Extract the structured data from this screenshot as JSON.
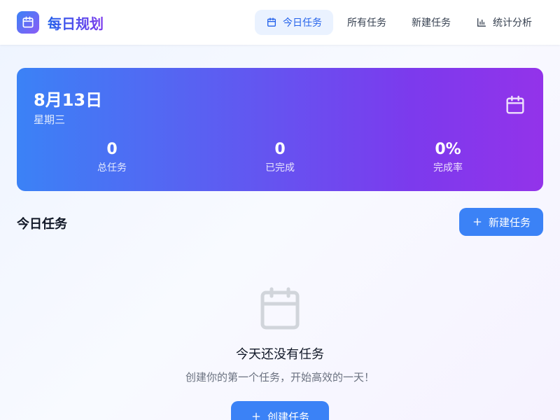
{
  "header": {
    "brand": "每日规划",
    "nav": [
      {
        "label": "今日任务",
        "icon": "calendar-icon",
        "active": true
      },
      {
        "label": "所有任务",
        "active": false
      },
      {
        "label": "新建任务",
        "active": false
      },
      {
        "label": "统计分析",
        "icon": "bar-chart-icon",
        "active": false
      }
    ]
  },
  "summary": {
    "date": "8月13日",
    "weekday": "星期三",
    "stats": [
      {
        "value": "0",
        "label": "总任务"
      },
      {
        "value": "0",
        "label": "已完成"
      },
      {
        "value": "0%",
        "label": "完成率"
      }
    ]
  },
  "section": {
    "title": "今日任务",
    "new_button": "新建任务"
  },
  "empty": {
    "title": "今天还没有任务",
    "description": "创建你的第一个任务，开始高效的一天！",
    "create_button": "创建任务"
  },
  "colors": {
    "primary": "#3b82f6",
    "accent": "#7c3aed",
    "nav_active_bg": "#eaf2ff"
  }
}
